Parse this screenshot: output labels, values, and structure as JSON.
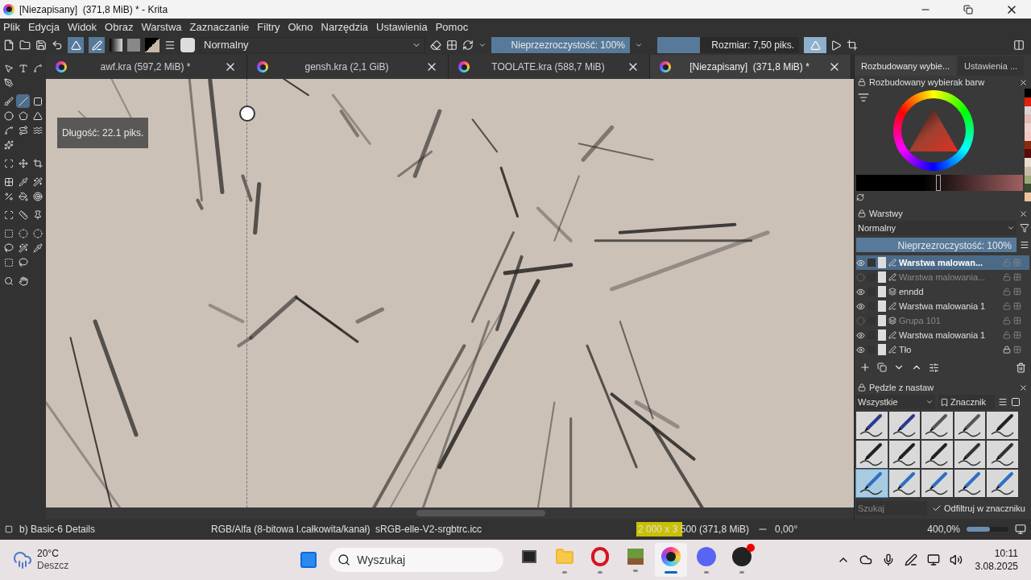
{
  "window": {
    "title": "[Niezapisany]  (371,8 MiB) * - Krita"
  },
  "menu": [
    "Plik",
    "Edycja",
    "Widok",
    "Obraz",
    "Warstwa",
    "Zaznaczanie",
    "Filtry",
    "Okno",
    "Narzędzia",
    "Ustawienia",
    "Pomoc"
  ],
  "toolbar": {
    "toggles": [
      {
        "kind": "mirror",
        "on": true
      },
      {
        "kind": "pressure",
        "on": true
      }
    ],
    "blend_mode": "Normalny",
    "opacity": {
      "label": "Nieprzezroczystość: 100%",
      "level": 1
    },
    "size": {
      "label": "Rozmiar: 7,50 piks.",
      "level": 0.3
    },
    "mirror_on": true
  },
  "toolbox": {
    "groups": [
      {
        "tools": [
          {
            "kind": "select",
            "selected": false
          },
          {
            "kind": "text",
            "selected": false
          },
          {
            "kind": "edit-shape",
            "selected": false
          },
          {
            "kind": "calligraphy",
            "selected": false
          }
        ]
      },
      {
        "tools": [
          {
            "kind": "brush",
            "selected": false
          },
          {
            "kind": "line",
            "selected": true
          },
          {
            "kind": "rectangle",
            "selected": false
          },
          {
            "kind": "ellipse",
            "selected": false
          },
          {
            "kind": "polygon",
            "selected": false
          },
          {
            "kind": "polyline",
            "selected": false
          },
          {
            "kind": "bezier",
            "selected": false
          },
          {
            "kind": "freehand-path",
            "selected": false
          },
          {
            "kind": "curve",
            "selected": false
          },
          {
            "kind": "multibrush",
            "selected": false
          }
        ]
      },
      {
        "tools": [
          {
            "kind": "transform",
            "selected": false
          },
          {
            "kind": "move",
            "selected": false
          },
          {
            "kind": "crop",
            "selected": false
          }
        ]
      },
      {
        "tools": [
          {
            "kind": "gradient",
            "selected": false
          },
          {
            "kind": "picker",
            "selected": false
          },
          {
            "kind": "smart-patch",
            "selected": false
          },
          {
            "kind": "pattern",
            "selected": false
          },
          {
            "kind": "fill",
            "selected": false
          },
          {
            "kind": "enclose",
            "selected": false
          }
        ]
      },
      {
        "tools": [
          {
            "kind": "assistant",
            "selected": false
          },
          {
            "kind": "measure",
            "selected": false
          },
          {
            "kind": "pin",
            "selected": false
          }
        ]
      },
      {
        "tools": [
          {
            "kind": "rect-select",
            "selected": false
          },
          {
            "kind": "ellipse-select",
            "selected": false
          },
          {
            "kind": "poly-select",
            "selected": false
          },
          {
            "kind": "lasso",
            "selected": false
          },
          {
            "kind": "wand",
            "selected": false
          },
          {
            "kind": "similar",
            "selected": false
          },
          {
            "kind": "bezier-select",
            "selected": false
          },
          {
            "kind": "magnetic",
            "selected": false
          }
        ]
      },
      {
        "tools": [
          {
            "kind": "zoom",
            "selected": false
          },
          {
            "kind": "pan",
            "selected": false
          }
        ]
      }
    ]
  },
  "tabs": [
    {
      "label": "awf.kra (597,2 MiB) *",
      "selected": false
    },
    {
      "label": "gensh.kra (2,1 GiB)",
      "selected": false
    },
    {
      "label": "TOOLATE.kra (588,7 MiB)",
      "selected": false
    },
    {
      "label": "[Niezapisany]  (371,8 MiB) *",
      "selected": true
    }
  ],
  "canvas": {
    "tooltip": "Długość: 22.1 piks."
  },
  "dock_tabs": [
    {
      "label": "Rozbudowany wybie...",
      "selected": true
    },
    {
      "label": "Ustawienia ...",
      "selected": false
    }
  ],
  "color_panel": {
    "title": "Rozbudowany wybierak barw",
    "value_slider": {
      "level": 0.48
    },
    "swatches": [
      {
        "color": "#000000"
      },
      {
        "color": "#e0200f"
      },
      {
        "color": "#d8d4d2"
      },
      {
        "color": "#e3b9b4"
      },
      {
        "color": "#f0d0cc"
      },
      {
        "color": "#f2c9c4"
      },
      {
        "color": "#8a2a10"
      },
      {
        "color": "#5a0a08"
      },
      {
        "color": "#e8dcd0"
      },
      {
        "color": "#c8bca8"
      },
      {
        "color": "#9caa78"
      },
      {
        "color": "#3a4a30"
      },
      {
        "color": "#f0c0a0"
      }
    ]
  },
  "layers": {
    "title": "Warstwy",
    "blend_mode": "Normalny",
    "opacity": {
      "label": "Nieprzezroczystość:  100%",
      "level": 1
    },
    "rows": [
      {
        "name": "Warstwa malowan...",
        "kind": "paint",
        "visible": true,
        "selected": true,
        "locked": false
      },
      {
        "name": "Warstwa malowania...",
        "kind": "paint",
        "visible": false,
        "selected": false,
        "locked": false
      },
      {
        "name": "enndd",
        "kind": "group",
        "visible": true,
        "selected": false,
        "locked": false
      },
      {
        "name": "Warstwa malowania 1",
        "kind": "paint",
        "visible": true,
        "selected": false,
        "locked": false
      },
      {
        "name": "Grupa 101",
        "kind": "group",
        "visible": false,
        "selected": false,
        "locked": false
      },
      {
        "name": "Warstwa malowania 1",
        "kind": "paint",
        "visible": true,
        "selected": false,
        "locked": false
      },
      {
        "name": "Tło",
        "kind": "paint",
        "visible": true,
        "selected": false,
        "locked": true
      }
    ]
  },
  "brushes": {
    "title": "Pędzle z nastaw",
    "filter": "Wszystkie",
    "tag": "Znacznik",
    "search": {
      "placeholder": "Szukaj"
    },
    "tag_filter": {
      "label": "Odfiltruj w znaczniku",
      "checked": true
    },
    "presets": [
      {
        "kind": "eraser",
        "selected": false
      },
      {
        "kind": "eraser",
        "selected": false
      },
      {
        "kind": "airbrush",
        "selected": false
      },
      {
        "kind": "airbrush",
        "selected": false
      },
      {
        "kind": "pen",
        "selected": false
      },
      {
        "kind": "pen",
        "selected": false
      },
      {
        "kind": "pen",
        "selected": false
      },
      {
        "kind": "pen",
        "selected": false
      },
      {
        "kind": "ink",
        "selected": false
      },
      {
        "kind": "ink",
        "selected": false
      },
      {
        "kind": "pencil",
        "selected": true
      },
      {
        "kind": "pencil",
        "selected": false
      },
      {
        "kind": "pencil",
        "selected": false
      },
      {
        "kind": "pencil",
        "selected": false
      },
      {
        "kind": "pencil",
        "selected": false
      }
    ]
  },
  "status": {
    "brush": "b) Basic-6 Details",
    "color_space": "RGB/Alfa (8-bitowa l.całkowita/kanał)  sRGB-elle-V2-srgbtrc.icc",
    "image_size": {
      "text": "2 000 x 3 500 (371,8 MiB)",
      "level": 0.4
    },
    "rotation": "0,00°",
    "zoom": "400,0%",
    "zoom_slider": {
      "level": 0.55
    }
  },
  "taskbar": {
    "temperature": "20°C",
    "weather": "Deszcz",
    "search": {
      "placeholder": "Wyszukaj"
    },
    "apps": [
      {
        "kind": "task-view",
        "running": false,
        "active": false
      },
      {
        "kind": "folder",
        "running": true,
        "active": false
      },
      {
        "kind": "opera",
        "running": true,
        "active": false
      },
      {
        "kind": "minecraft",
        "running": true,
        "active": false
      },
      {
        "kind": "krita",
        "running": true,
        "active": true
      },
      {
        "kind": "discord",
        "running": true,
        "active": false
      },
      {
        "kind": "obs",
        "running": true,
        "active": false
      }
    ],
    "time": "10:11",
    "date": "3.08.2025"
  }
}
